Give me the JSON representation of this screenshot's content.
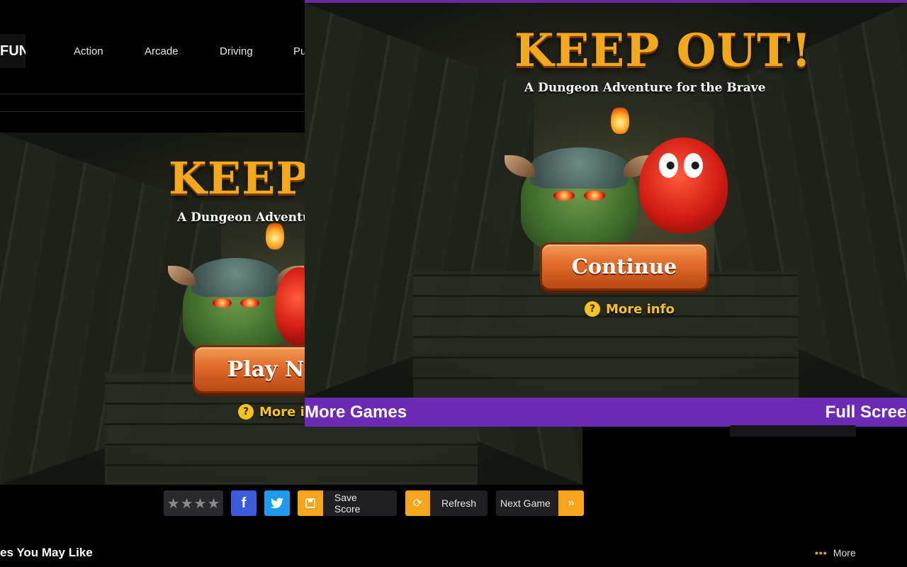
{
  "site": {
    "logo_text": "FUN"
  },
  "nav": {
    "items": [
      "Action",
      "Arcade",
      "Driving",
      "Pu"
    ]
  },
  "game": {
    "title": "KEEP OUT!",
    "subtitle": "A Dungeon Adventure for the Brave",
    "background_title": "KEEP O",
    "background_subtitle": "A Dungeon Adventure",
    "play_label": "Play No",
    "continue_label": "Continue",
    "more_info_label": "More info",
    "background_more_info_label": "More in"
  },
  "overlay": {
    "more_games_label": "More Games",
    "full_screen_label": "Full Screen",
    "accent_color": "#6b2bb5"
  },
  "toolbar": {
    "rating_stars": 0,
    "save_score_label": "Save Score",
    "refresh_label": "Refresh",
    "next_game_label": "Next Game"
  },
  "section": {
    "title": "es You May Like",
    "more_label": "More"
  },
  "icons": {
    "facebook": "facebook-icon",
    "twitter": "twitter-icon",
    "save": "floppy-disk-icon",
    "refresh": "refresh-icon",
    "next": "double-chevron-right-icon",
    "info": "question-bubble-icon"
  }
}
